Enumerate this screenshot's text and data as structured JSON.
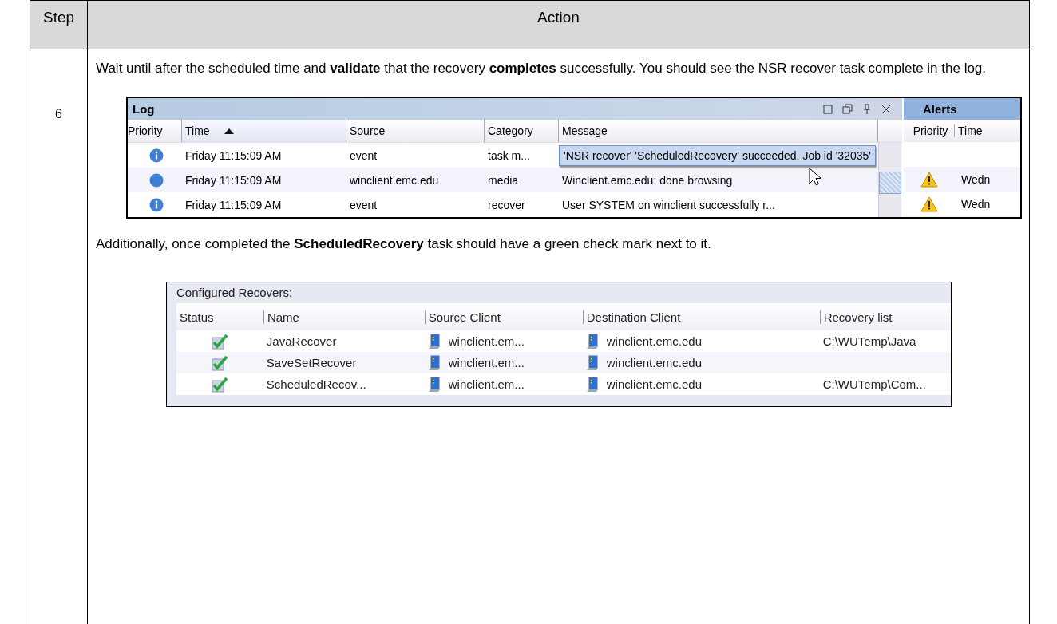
{
  "table": {
    "columns": [
      {
        "label": "Step"
      },
      {
        "label": "Action"
      }
    ],
    "step": "6",
    "intro": "Wait until after the scheduled time and **validate** that the recovery **completes** successfully.  You should see the NSR recover task complete in the log.",
    "log_panel": {
      "title": "Log",
      "columns": [
        {
          "label": "Priority",
          "sorted": false
        },
        {
          "label": "Time",
          "sorted": true
        },
        {
          "label": "Source",
          "sorted": false
        },
        {
          "label": "Category",
          "sorted": false
        },
        {
          "label": "Message",
          "sorted": false
        }
      ],
      "rows": [
        {
          "kind": "info",
          "time": "Friday 11:15:09 AM",
          "source": "event",
          "category": "task m...",
          "message": "'NSR recover' 'ScheduledRecovery' succeeded. Job id '32035'",
          "selected": true
        },
        {
          "kind": "plain",
          "time": "Friday 11:15:09 AM",
          "source": "winclient.emc.edu",
          "category": "media",
          "message": "Winclient.emc.edu: done browsing",
          "selected": false
        },
        {
          "kind": "info",
          "time": "Friday 11:15:09 AM",
          "source": "event",
          "category": "recover",
          "message": "User SYSTEM on winclient successfully r...",
          "selected": false
        }
      ],
      "alerts": {
        "title": "Alerts",
        "columns": [
          "Priority",
          "Time"
        ],
        "rows": [
          {
            "kind": "warning",
            "time": "Wedn"
          },
          {
            "kind": "warning",
            "time": "Wedn"
          }
        ]
      }
    },
    "followup": "Additionally, once completed the **ScheduledRecovery** task should have a green check mark next to it.",
    "recovers_panel": {
      "title": "Configured Recovers:",
      "columns": [
        "Status",
        "Name",
        "Source Client",
        "Destination Client",
        "Recovery list"
      ],
      "rows": [
        {
          "kind": "ok",
          "name": "JavaRecover",
          "source": "winclient.em...",
          "destination": "winclient.emc.edu",
          "list": "C:\\WUTemp\\Java"
        },
        {
          "kind": "ok",
          "name": "SaveSetRecover",
          "source": "winclient.em...",
          "destination": "winclient.emc.edu"
        },
        {
          "kind": "ok",
          "name": "ScheduledRecov...",
          "source": "winclient.em...",
          "destination": "winclient.emc.edu",
          "list": "C:\\WUTemp\\Com..."
        }
      ]
    }
  }
}
